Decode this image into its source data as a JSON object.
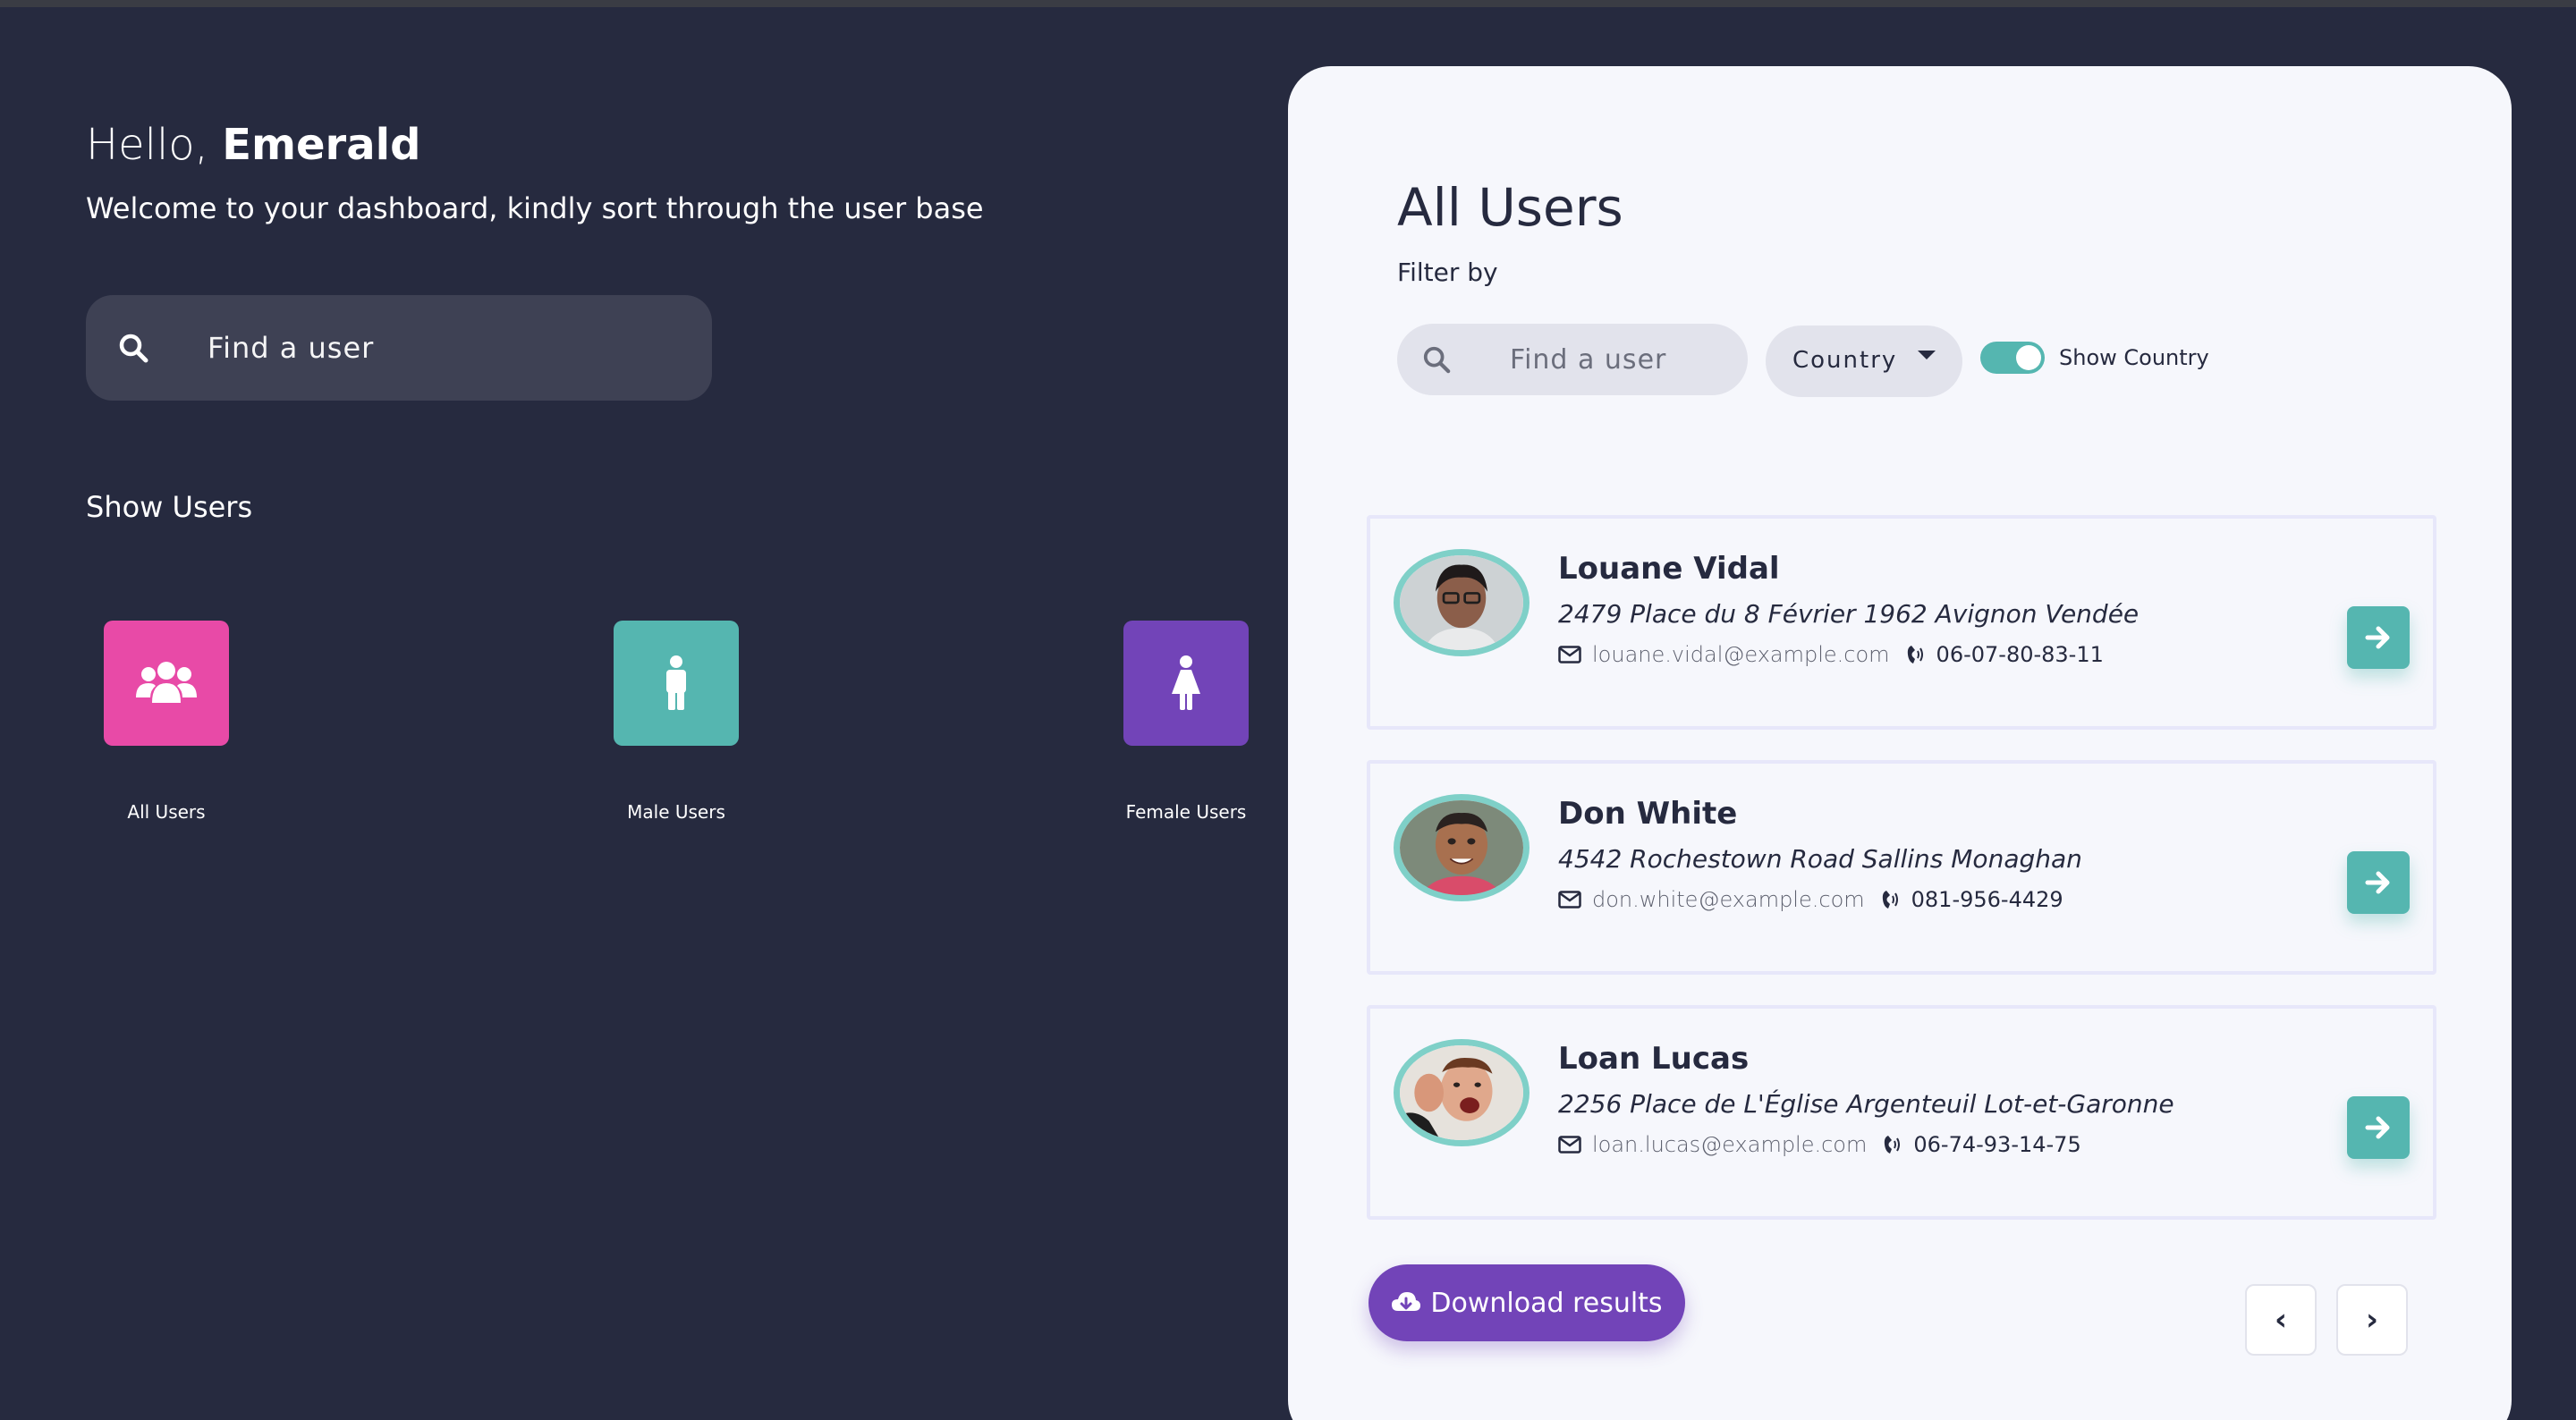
{
  "left": {
    "greeting": "Hello,",
    "user_name": "Emerald",
    "subtitle": "Welcome to your dashboard, kindly sort through the user base",
    "search_placeholder": "Find a user",
    "show_users_heading": "Show Users",
    "categories": [
      {
        "label": "All Users",
        "icon": "users-group-icon",
        "color": "#e84aa7"
      },
      {
        "label": "Male Users",
        "icon": "male-icon",
        "color": "#55b6b0"
      },
      {
        "label": "Female Users",
        "icon": "female-icon",
        "color": "#7244b8"
      }
    ]
  },
  "panel": {
    "title": "All Users",
    "filter_label": "Filter by",
    "search_placeholder": "Find a user",
    "country_select": "Country",
    "toggle_label": "Show Country",
    "toggle_on": true,
    "users": [
      {
        "name": "Louane Vidal",
        "address": "2479 Place du 8 Février 1962 Avignon Vendée",
        "email": "louane.vidal@example.com",
        "phone": "06-07-80-83-11"
      },
      {
        "name": "Don White",
        "address": "4542 Rochestown Road Sallins Monaghan",
        "email": "don.white@example.com",
        "phone": "081-956-4429"
      },
      {
        "name": "Loan Lucas",
        "address": "2256 Place de L'Église Argenteuil Lot-et-Garonne",
        "email": "loan.lucas@example.com",
        "phone": "06-74-93-14-75"
      }
    ],
    "download_label": "Download results",
    "prev_label": "‹",
    "next_label": "›"
  },
  "colors": {
    "background": "#262a3f",
    "panel": "#f6f7fc",
    "teal": "#55b6b0",
    "pink": "#e84aa7",
    "purple": "#7244b8"
  }
}
